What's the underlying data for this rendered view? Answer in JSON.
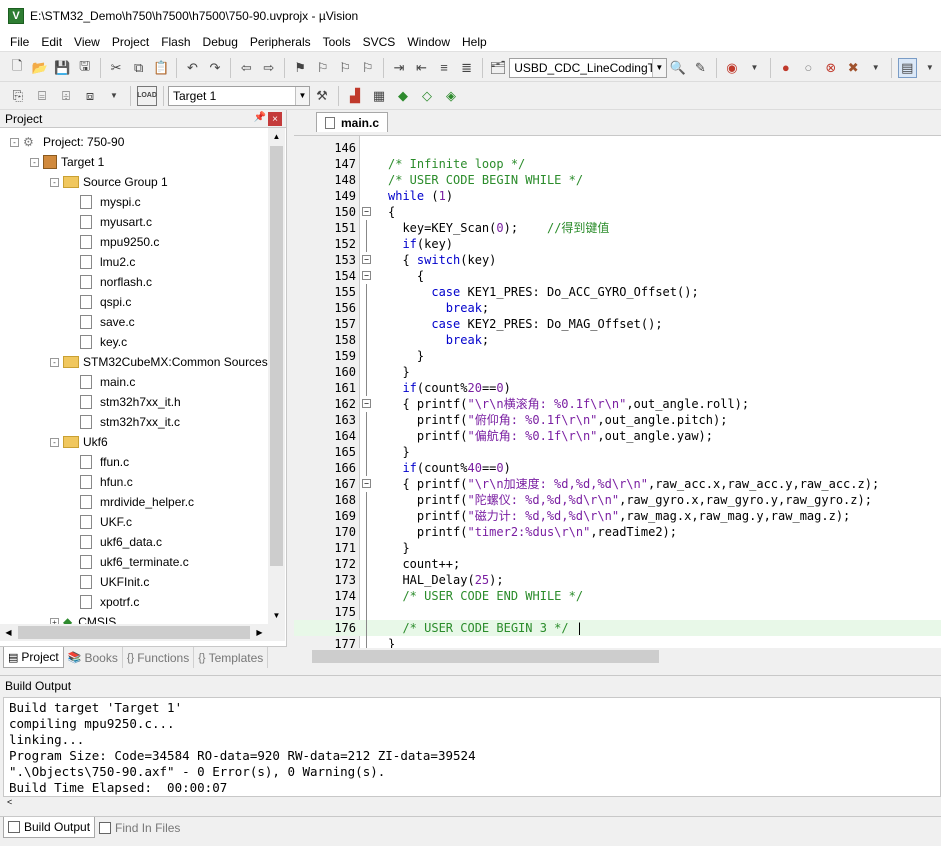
{
  "window": {
    "title": "E:\\STM32_Demo\\h750\\h7500\\h7500\\750-90.uvprojx - µVision"
  },
  "menu": [
    "File",
    "Edit",
    "View",
    "Project",
    "Flash",
    "Debug",
    "Peripherals",
    "Tools",
    "SVCS",
    "Window",
    "Help"
  ],
  "toolbar": {
    "find_combo": "USBD_CDC_LineCodingTy",
    "target_combo": "Target 1"
  },
  "project_panel": {
    "title": "Project",
    "pin": "ᵖ",
    "close": "×",
    "tree": [
      {
        "label": "Project: 750-90",
        "kind": "project",
        "level": 0,
        "expander": "-"
      },
      {
        "label": "Target 1",
        "kind": "target",
        "level": 1,
        "expander": "-"
      },
      {
        "label": "Source Group 1",
        "kind": "folder",
        "level": 2,
        "expander": "-"
      },
      {
        "label": "myspi.c",
        "kind": "file",
        "level": 3
      },
      {
        "label": "myusart.c",
        "kind": "file",
        "level": 3
      },
      {
        "label": "mpu9250.c",
        "kind": "file",
        "level": 3
      },
      {
        "label": "lmu2.c",
        "kind": "file",
        "level": 3
      },
      {
        "label": "norflash.c",
        "kind": "file",
        "level": 3
      },
      {
        "label": "qspi.c",
        "kind": "file",
        "level": 3
      },
      {
        "label": "save.c",
        "kind": "file",
        "level": 3
      },
      {
        "label": "key.c",
        "kind": "file",
        "level": 3
      },
      {
        "label": "STM32CubeMX:Common Sources",
        "kind": "folder",
        "level": 2,
        "expander": "-"
      },
      {
        "label": "main.c",
        "kind": "file",
        "level": 3
      },
      {
        "label": "stm32h7xx_it.h",
        "kind": "file",
        "level": 3
      },
      {
        "label": "stm32h7xx_it.c",
        "kind": "file",
        "level": 3
      },
      {
        "label": "Ukf6",
        "kind": "folder",
        "level": 2,
        "expander": "-"
      },
      {
        "label": "ffun.c",
        "kind": "file",
        "level": 3
      },
      {
        "label": "hfun.c",
        "kind": "file",
        "level": 3
      },
      {
        "label": "mrdivide_helper.c",
        "kind": "file",
        "level": 3
      },
      {
        "label": "UKF.c",
        "kind": "file",
        "level": 3
      },
      {
        "label": "ukf6_data.c",
        "kind": "file",
        "level": 3
      },
      {
        "label": "ukf6_terminate.c",
        "kind": "file",
        "level": 3
      },
      {
        "label": "UKFInit.c",
        "kind": "file",
        "level": 3
      },
      {
        "label": "xpotrf.c",
        "kind": "file",
        "level": 3
      },
      {
        "label": "CMSIS",
        "kind": "cmsis",
        "level": 2,
        "expander": "+"
      }
    ],
    "tabs": [
      {
        "label": "Project",
        "active": true
      },
      {
        "label": "Books",
        "active": false
      },
      {
        "label": "Functions",
        "active": false
      },
      {
        "label": "Templates",
        "active": false
      }
    ]
  },
  "editor": {
    "tab": "main.c",
    "lines": [
      {
        "n": "146",
        "fold": "",
        "hl": false,
        "parts": []
      },
      {
        "n": "147",
        "fold": "",
        "hl": false,
        "parts": [
          [
            "c",
            "/* Infinite loop */"
          ]
        ]
      },
      {
        "n": "148",
        "fold": "",
        "hl": false,
        "parts": [
          [
            "c",
            "/* USER CODE BEGIN WHILE */"
          ]
        ]
      },
      {
        "n": "149",
        "fold": "",
        "hl": false,
        "parts": [
          [
            "k",
            "while"
          ],
          [
            "t",
            " ("
          ],
          [
            "n",
            "1"
          ],
          [
            "t",
            ")"
          ]
        ]
      },
      {
        "n": "150",
        "fold": "-",
        "hl": false,
        "parts": [
          [
            "t",
            "{"
          ]
        ]
      },
      {
        "n": "151",
        "fold": "|",
        "hl": false,
        "parts": [
          [
            "t",
            "  key=KEY_Scan("
          ],
          [
            "n",
            "0"
          ],
          [
            "t",
            ");    "
          ],
          [
            "c",
            "//得到键值"
          ]
        ]
      },
      {
        "n": "152",
        "fold": "|",
        "hl": false,
        "parts": [
          [
            "t",
            "  "
          ],
          [
            "k",
            "if"
          ],
          [
            "t",
            "(key)"
          ]
        ]
      },
      {
        "n": "153",
        "fold": "-",
        "hl": false,
        "parts": [
          [
            "t",
            "  { "
          ],
          [
            "k",
            "switch"
          ],
          [
            "t",
            "(key)"
          ]
        ]
      },
      {
        "n": "154",
        "fold": "-",
        "hl": false,
        "parts": [
          [
            "t",
            "    {"
          ]
        ]
      },
      {
        "n": "155",
        "fold": "|",
        "hl": false,
        "parts": [
          [
            "t",
            "      "
          ],
          [
            "k",
            "case"
          ],
          [
            "t",
            " KEY1_PRES: Do_ACC_GYRO_Offset();"
          ]
        ]
      },
      {
        "n": "156",
        "fold": "|",
        "hl": false,
        "parts": [
          [
            "t",
            "        "
          ],
          [
            "k",
            "break"
          ],
          [
            "t",
            ";"
          ]
        ]
      },
      {
        "n": "157",
        "fold": "|",
        "hl": false,
        "parts": [
          [
            "t",
            "      "
          ],
          [
            "k",
            "case"
          ],
          [
            "t",
            " KEY2_PRES: Do_MAG_Offset();"
          ]
        ]
      },
      {
        "n": "158",
        "fold": "|",
        "hl": false,
        "parts": [
          [
            "t",
            "        "
          ],
          [
            "k",
            "break"
          ],
          [
            "t",
            ";"
          ]
        ]
      },
      {
        "n": "159",
        "fold": "|",
        "hl": false,
        "parts": [
          [
            "t",
            "    }"
          ]
        ]
      },
      {
        "n": "160",
        "fold": "|",
        "hl": false,
        "parts": [
          [
            "t",
            "  }"
          ]
        ]
      },
      {
        "n": "161",
        "fold": "|",
        "hl": false,
        "parts": [
          [
            "t",
            "  "
          ],
          [
            "k",
            "if"
          ],
          [
            "t",
            "(count%"
          ],
          [
            "n",
            "20"
          ],
          [
            "t",
            "=="
          ],
          [
            "n",
            "0"
          ],
          [
            "t",
            ")"
          ]
        ]
      },
      {
        "n": "162",
        "fold": "-",
        "hl": false,
        "parts": [
          [
            "t",
            "  { printf("
          ],
          [
            "s",
            "\"\\r\\n横滚角: %0.1f\\r\\n\""
          ],
          [
            "t",
            ",out_angle.roll);"
          ]
        ]
      },
      {
        "n": "163",
        "fold": "|",
        "hl": false,
        "parts": [
          [
            "t",
            "    printf("
          ],
          [
            "s",
            "\"俯仰角: %0.1f\\r\\n\""
          ],
          [
            "t",
            ",out_angle.pitch);"
          ]
        ]
      },
      {
        "n": "164",
        "fold": "|",
        "hl": false,
        "parts": [
          [
            "t",
            "    printf("
          ],
          [
            "s",
            "\"偏航角: %0.1f\\r\\n\""
          ],
          [
            "t",
            ",out_angle.yaw);"
          ]
        ]
      },
      {
        "n": "165",
        "fold": "|",
        "hl": false,
        "parts": [
          [
            "t",
            "  }"
          ]
        ]
      },
      {
        "n": "166",
        "fold": "|",
        "hl": false,
        "parts": [
          [
            "t",
            "  "
          ],
          [
            "k",
            "if"
          ],
          [
            "t",
            "(count%"
          ],
          [
            "n",
            "40"
          ],
          [
            "t",
            "=="
          ],
          [
            "n",
            "0"
          ],
          [
            "t",
            ")"
          ]
        ]
      },
      {
        "n": "167",
        "fold": "-",
        "hl": false,
        "parts": [
          [
            "t",
            "  { printf("
          ],
          [
            "s",
            "\"\\r\\n加速度: %d,%d,%d\\r\\n\""
          ],
          [
            "t",
            ",raw_acc.x,raw_acc.y,raw_acc.z);"
          ]
        ]
      },
      {
        "n": "168",
        "fold": "|",
        "hl": false,
        "parts": [
          [
            "t",
            "    printf("
          ],
          [
            "s",
            "\"陀螺仪: %d,%d,%d\\r\\n\""
          ],
          [
            "t",
            ",raw_gyro.x,raw_gyro.y,raw_gyro.z);"
          ]
        ]
      },
      {
        "n": "169",
        "fold": "|",
        "hl": false,
        "parts": [
          [
            "t",
            "    printf("
          ],
          [
            "s",
            "\"磁力计: %d,%d,%d\\r\\n\""
          ],
          [
            "t",
            ",raw_mag.x,raw_mag.y,raw_mag.z);"
          ]
        ]
      },
      {
        "n": "170",
        "fold": "|",
        "hl": false,
        "parts": [
          [
            "t",
            "    printf("
          ],
          [
            "s",
            "\"timer2:%dus\\r\\n\""
          ],
          [
            "t",
            ",readTime2);"
          ]
        ]
      },
      {
        "n": "171",
        "fold": "|",
        "hl": false,
        "parts": [
          [
            "t",
            "  }"
          ]
        ]
      },
      {
        "n": "172",
        "fold": "|",
        "hl": false,
        "parts": [
          [
            "t",
            "  count++;"
          ]
        ]
      },
      {
        "n": "173",
        "fold": "|",
        "hl": false,
        "parts": [
          [
            "t",
            "  HAL_Delay("
          ],
          [
            "n",
            "25"
          ],
          [
            "t",
            ");"
          ]
        ]
      },
      {
        "n": "174",
        "fold": "|",
        "hl": false,
        "parts": [
          [
            "t",
            "  "
          ],
          [
            "c",
            "/* USER CODE END WHILE */"
          ]
        ]
      },
      {
        "n": "175",
        "fold": "|",
        "hl": false,
        "parts": []
      },
      {
        "n": "176",
        "fold": "|",
        "hl": true,
        "parts": [
          [
            "t",
            "  "
          ],
          [
            "c",
            "/* USER CODE BEGIN 3 */"
          ],
          [
            "t",
            " |"
          ]
        ]
      },
      {
        "n": "177",
        "fold": "|",
        "hl": false,
        "parts": [
          [
            "t",
            "}"
          ]
        ]
      }
    ]
  },
  "build_output": {
    "title": "Build Output",
    "lines": [
      "Build target 'Target 1'",
      "compiling mpu9250.c...",
      "linking...",
      "Program Size: Code=34584 RO-data=920 RW-data=212 ZI-data=39524",
      "\".\\Objects\\750-90.axf\" - 0 Error(s), 0 Warning(s).",
      "Build Time Elapsed:  00:00:07"
    ],
    "scroll_left": "<",
    "tabs": [
      {
        "label": "Build Output",
        "active": true
      },
      {
        "label": "Find In Files",
        "active": false
      }
    ]
  }
}
